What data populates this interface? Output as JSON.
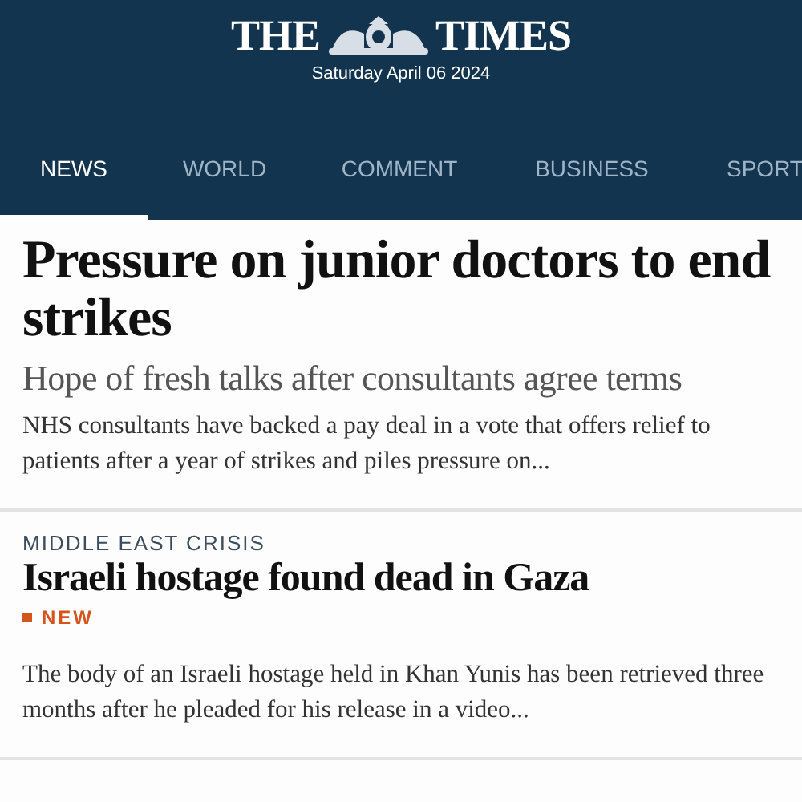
{
  "masthead": {
    "title_left": "THE",
    "title_right": "TIMES",
    "date": "Saturday April 06 2024"
  },
  "tabs": [
    {
      "label": "NEWS",
      "selected": true
    },
    {
      "label": "WORLD",
      "selected": false
    },
    {
      "label": "COMMENT",
      "selected": false
    },
    {
      "label": "BUSINESS",
      "selected": false
    },
    {
      "label": "SPORT",
      "selected": false
    }
  ],
  "stories": [
    {
      "headline": "Pressure on junior doctors to end strikes",
      "subheadline": "Hope of fresh talks after consultants agree terms",
      "summary": "NHS consultants have backed a pay deal in a vote that offers relief to patients after a year of strikes and piles pressure on...",
      "lead": true
    },
    {
      "section": "MIDDLE EAST CRISIS",
      "headline": "Israeli hostage found dead in Gaza",
      "badge": "NEW",
      "summary": "The body of an Israeli hostage held in Khan Yunis has been retrieved three months after he pleaded for his release in a video...",
      "lead": false
    }
  ]
}
